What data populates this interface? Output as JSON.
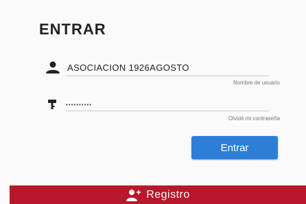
{
  "login": {
    "title": "ENTRAR",
    "username_value": "ASOCIACION 1926AGOSTO",
    "username_hint": "Nombre de usuario",
    "password_value": "••••••••••",
    "password_hint": "Olvidé mi contraseña",
    "enter_label": "Entrar",
    "register_label": "Registro"
  },
  "icons": {
    "user": "user-icon",
    "password": "key-icon",
    "register": "add-user-icon"
  },
  "colors": {
    "primary_button": "#2d7fd6",
    "register_bar": "#b8182a"
  }
}
